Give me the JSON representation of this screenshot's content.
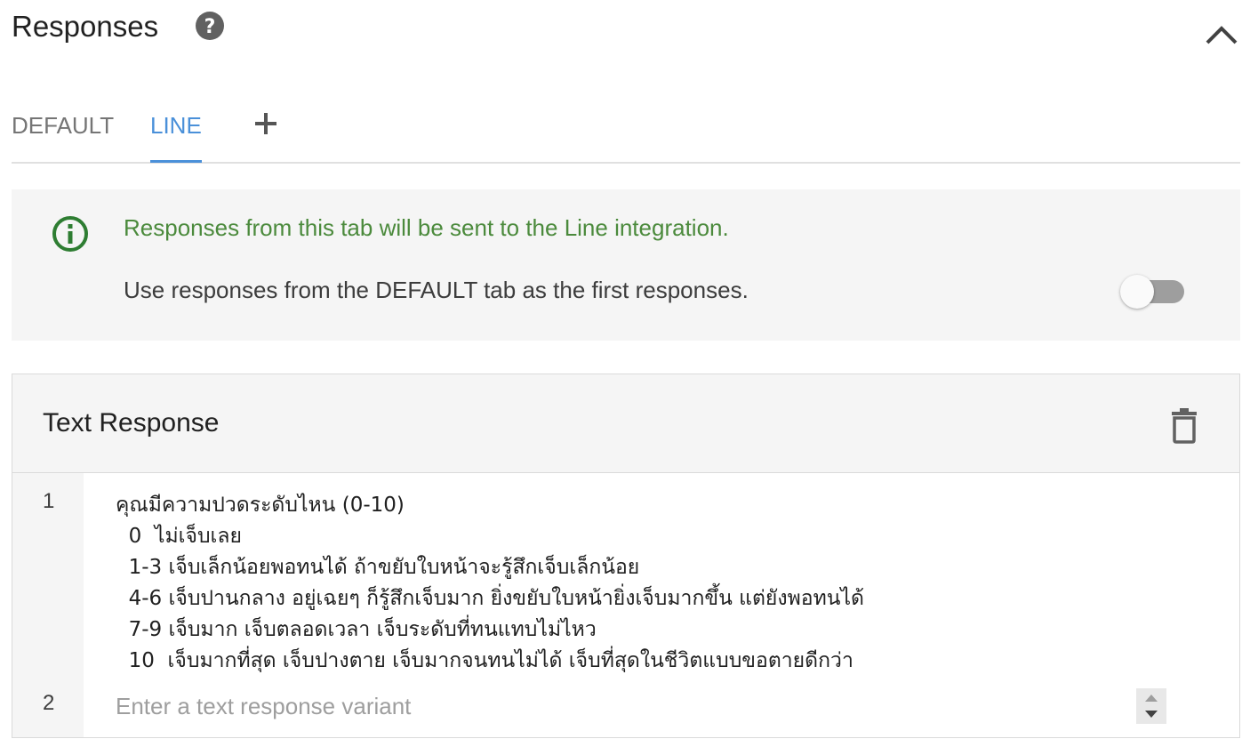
{
  "header": {
    "title": "Responses",
    "help_icon": "help-circle-icon",
    "collapse_icon": "chevron-up-icon"
  },
  "tabs": [
    {
      "label": "DEFAULT",
      "active": false
    },
    {
      "label": "LINE",
      "active": true
    }
  ],
  "add_tab_icon": "plus-icon",
  "info": {
    "icon": "info-circle-icon",
    "message": "Responses from this tab will be sent to the Line integration.",
    "option_label": "Use responses from the DEFAULT tab as the first responses.",
    "toggle_on": false
  },
  "card": {
    "title": "Text Response",
    "delete_icon": "trash-icon",
    "line_numbers": [
      "1",
      "2"
    ],
    "response_text": "คุณมีความปวดระดับไหน (0-10)\n  0  ไม่เจ็บเลย\n  1-3 เจ็บเล็กน้อยพอทนได้ ถ้าขยับใบหน้าจะรู้สึกเจ็บเล็กน้อย\n  4-6 เจ็บปานกลาง อยู่เฉยๆ ก็รู้สึกเจ็บมาก ยิ่งขยับใบหน้ายิ่งเจ็บมากขึ้น แต่ยังพอทนได้\n  7-9 เจ็บมาก เจ็บตลอดเวลา เจ็บระดับที่ทนแทบไม่ไหว\n  10  เจ็บมากที่สุด เจ็บปางตาย เจ็บมากจนทนไม่ได้ เจ็บที่สุดในชีวิตแบบขอตายดีกว่า",
    "variant_placeholder": "Enter a text response variant",
    "variant_value": ""
  },
  "colors": {
    "accent": "#4a90d9",
    "info_green": "#4b8a3c",
    "panel_bg": "#f5f5f5"
  }
}
